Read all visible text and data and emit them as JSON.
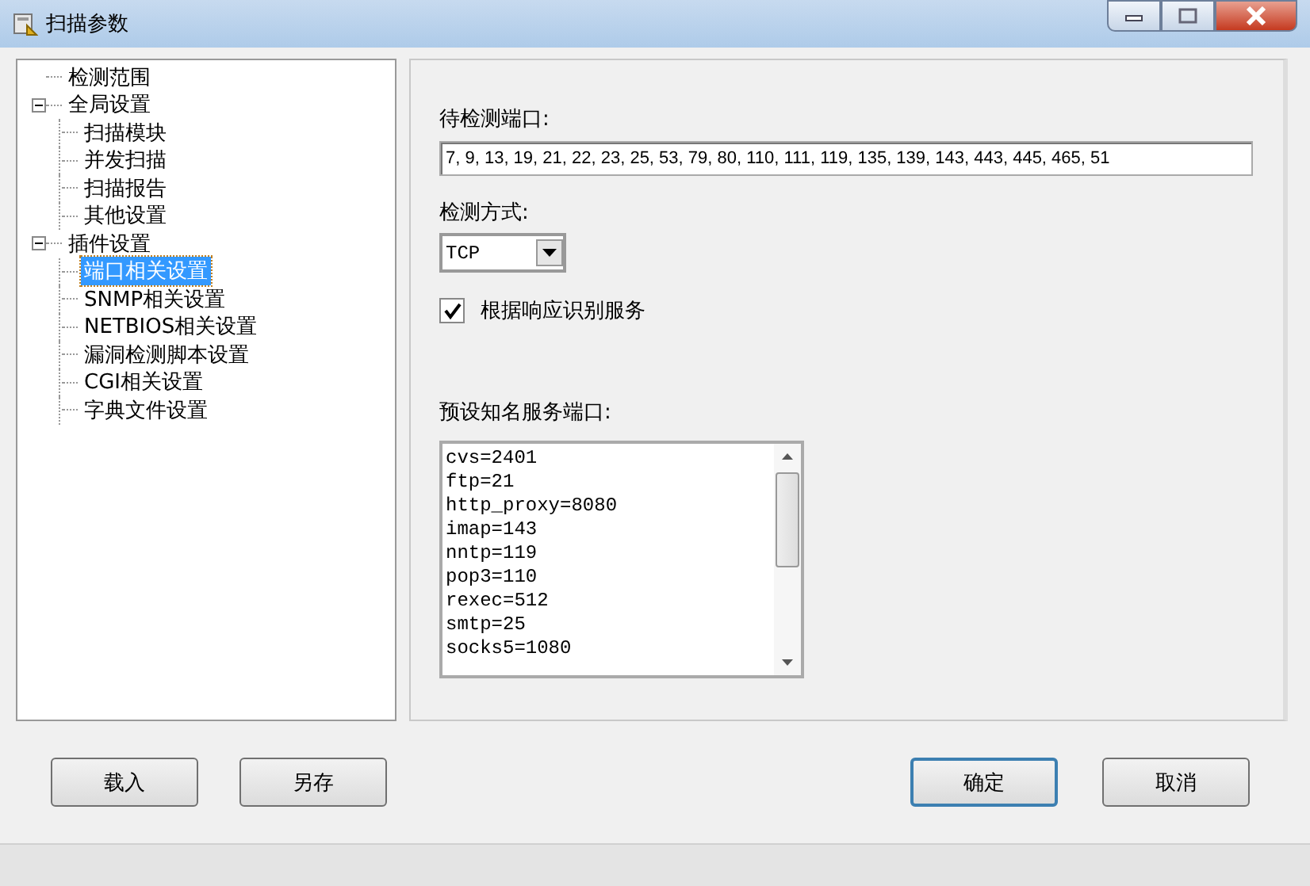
{
  "window": {
    "title": "扫描参数"
  },
  "tree": [
    {
      "label": "检测范围",
      "selected": false
    },
    {
      "label": "全局设置",
      "selected": false,
      "expanded": true,
      "children": [
        {
          "label": "扫描模块",
          "selected": false
        },
        {
          "label": "并发扫描",
          "selected": false
        },
        {
          "label": "扫描报告",
          "selected": false
        },
        {
          "label": "其他设置",
          "selected": false
        }
      ]
    },
    {
      "label": "插件设置",
      "selected": false,
      "expanded": true,
      "children": [
        {
          "label": "端口相关设置",
          "selected": true
        },
        {
          "label": "SNMP相关设置",
          "selected": false
        },
        {
          "label": "NETBIOS相关设置",
          "selected": false
        },
        {
          "label": "漏洞检测脚本设置",
          "selected": false
        },
        {
          "label": "CGI相关设置",
          "selected": false
        },
        {
          "label": "字典文件设置",
          "selected": false
        }
      ]
    }
  ],
  "ports": {
    "label": "待检测端口:",
    "value": "7, 9, 13, 19, 21, 22, 23, 25, 53, 79, 80, 110, 111, 119, 135, 139, 143, 443, 445, 465, 51"
  },
  "method": {
    "label": "检测方式:",
    "value": "TCP"
  },
  "identify": {
    "label": "根据响应识别服务",
    "checked": true
  },
  "services": {
    "label": "预设知名服务端口:",
    "items": [
      "cvs=2401",
      "ftp=21",
      "http_proxy=8080",
      "imap=143",
      "nntp=119",
      "pop3=110",
      "rexec=512",
      "smtp=25",
      "socks5=1080"
    ]
  },
  "buttons": [
    "载入",
    "另存",
    "确定",
    "取消"
  ]
}
